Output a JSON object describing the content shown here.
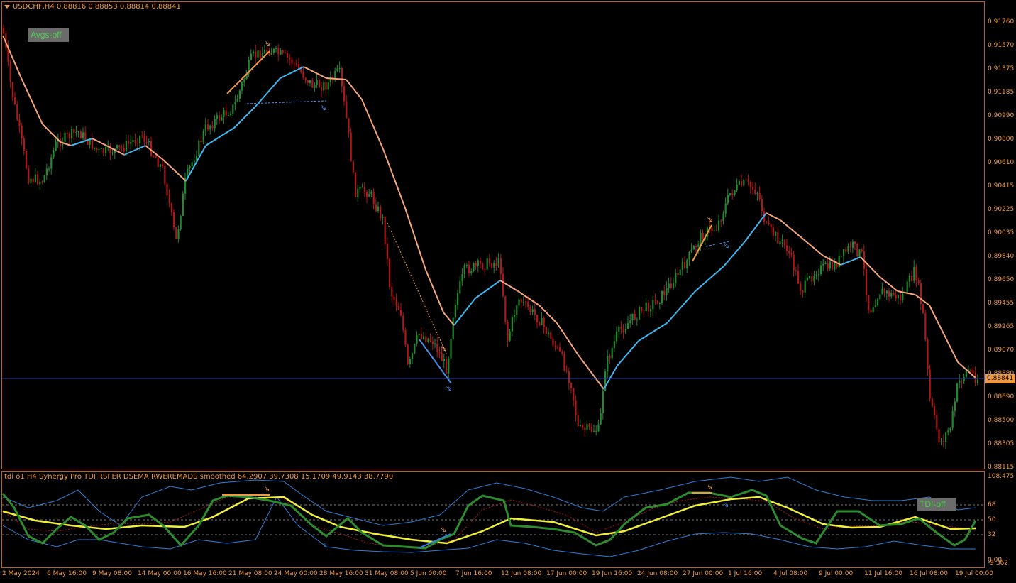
{
  "chart": {
    "title": "USDCHF,H4  0.88816 0.88853 0.88814 0.88841",
    "symbol": "USDCHF",
    "timeframe": "H4",
    "ohlc": {
      "open": 0.88816,
      "high": 0.88853,
      "low": 0.88814,
      "close": 0.88841
    },
    "current_price": "0.88841",
    "avgs_button": "Avgs-off",
    "price_axis": [
      "0.91760",
      "0.91570",
      "0.91375",
      "0.91185",
      "0.90990",
      "0.90800",
      "0.90610",
      "0.90415",
      "0.90225",
      "0.90035",
      "0.89840",
      "0.89650",
      "0.89455",
      "0.89265",
      "0.89070",
      "0.88880",
      "0.88690",
      "0.88500",
      "0.88305",
      "0.88115"
    ],
    "time_axis": [
      "2 May 2024",
      "6 May 16:00",
      "9 May 08:00",
      "14 May 00:00",
      "16 May 16:00",
      "21 May 08:00",
      "24 May 00:00",
      "28 May 16:00",
      "31 May 08:00",
      "5 Jun 00:00",
      "7 Jun 16:00",
      "12 Jun 08:00",
      "17 Jun 00:00",
      "19 Jun 16:00",
      "24 Jun 08:00",
      "27 Jun 00:00",
      "1 Jul 16:00",
      "4 Jul 08:00",
      "9 Jul 00:00",
      "11 Jul 16:00",
      "16 Jul 08:00",
      "19 Jul 00:00"
    ],
    "colors": {
      "bull": "#1f8a2e",
      "bear": "#b01818",
      "ma_up": "#3fb6f0",
      "ma_down": "#f5a57a",
      "trend_up": "#4a8ee8",
      "trend_down": "#f09a3e",
      "axis": "#f09a3e",
      "frame": "#b4642a",
      "price_line": "#2d3fa8"
    }
  },
  "indicator": {
    "title": "tdi o1 H4 Synergy Pro TDI RSI ER DSEMA RWEREMADS smoothed  64.2907 39.7308 15.1709 49.9143 38.7790",
    "values": [
      "64.2907",
      "39.7308",
      "15.1709",
      "49.9143",
      "38.7790"
    ],
    "button": "TDI-off",
    "axis": [
      "108.475",
      "68",
      "50",
      "32",
      "0.00",
      "-9.362"
    ],
    "colors": {
      "fast": "#2e8b2e",
      "signal": "#f0f03a",
      "bands": "#2e7fd6",
      "slow": "#b01818"
    }
  }
}
